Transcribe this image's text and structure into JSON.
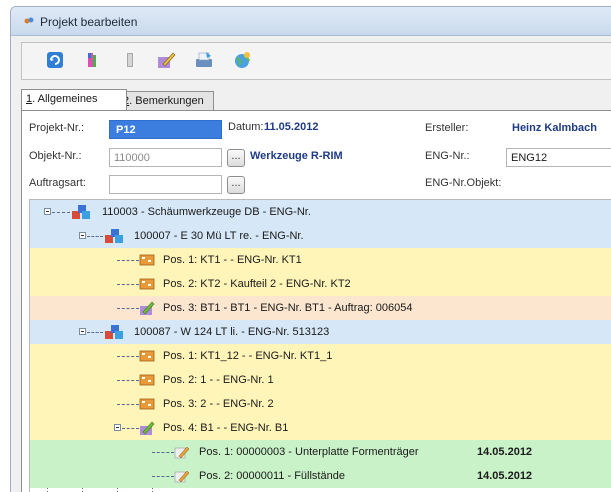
{
  "window": {
    "title": "Projekt bearbeiten"
  },
  "toolbar": {
    "buttons": [
      "refresh-icon",
      "color-icon",
      "bookmark-icon",
      "edit-icon",
      "print-icon",
      "globe-icon"
    ]
  },
  "tabs": [
    {
      "key": "1",
      "label": ". Allgemeines"
    },
    {
      "key": "2",
      "label": ". Bemerkungen"
    }
  ],
  "form": {
    "projekt_label": "Projekt-Nr.:",
    "projekt_value": "P12",
    "datum_label": "Datum:",
    "datum_value": "11.05.2012",
    "ersteller_label": "Ersteller:",
    "ersteller_value": "Heinz Kalmbach",
    "objekt_label": "Objekt-Nr.:",
    "objekt_value": "110000",
    "objekt_name": "Werkzeuge R-RIM",
    "eng_label": "ENG-Nr.:",
    "eng_value": "ENG12",
    "auftragsart_label": "Auftragsart:",
    "auftragsart_value": "",
    "eng_objekt_label": "ENG-Nr.Objekt:",
    "dots_label": "..."
  },
  "tree": {
    "rows": [
      {
        "text": "110003 - Schäumwerkzeuge DB - ENG-Nr.",
        "date": ""
      },
      {
        "text": "100007 - E 30 Mü LT re. - ENG-Nr.",
        "date": ""
      },
      {
        "text": "Pos. 1: KT1 -  - ENG-Nr. KT1",
        "date": ""
      },
      {
        "text": "Pos. 2: KT2 - Kaufteil 2 - ENG-Nr. KT2",
        "date": ""
      },
      {
        "text": "Pos. 3: BT1 - BT1 - ENG-Nr. BT1 - Auftrag: 006054",
        "date": ""
      },
      {
        "text": "100087 - W 124 LT li. - ENG-Nr. 513123",
        "date": ""
      },
      {
        "text": "Pos. 1: KT1_12 -  - ENG-Nr. KT1_1",
        "date": ""
      },
      {
        "text": "Pos. 2: 1 -  - ENG-Nr. 1",
        "date": ""
      },
      {
        "text": "Pos. 3: 2 -  - ENG-Nr. 2",
        "date": ""
      },
      {
        "text": "Pos. 4: B1 -  - ENG-Nr. B1",
        "date": ""
      },
      {
        "text": "Pos. 1: 00000003 - Unterplatte Formenträger",
        "date": "14.05.2012"
      },
      {
        "text": "Pos. 2: 00000011 - Füllstände",
        "date": "14.05.2012"
      }
    ]
  }
}
